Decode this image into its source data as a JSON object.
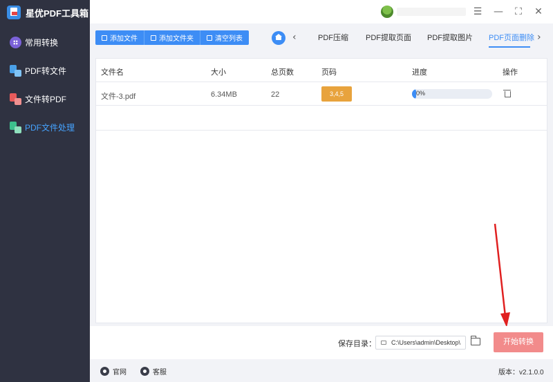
{
  "app": {
    "name": "星优PDF工具箱"
  },
  "sidebar": {
    "items": [
      {
        "label": "常用转换",
        "icon": "grid-icon"
      },
      {
        "label": "PDF转文件",
        "icon": "pdf-to-file-icon"
      },
      {
        "label": "文件转PDF",
        "icon": "file-to-pdf-icon"
      },
      {
        "label": "PDF文件处理",
        "icon": "pdf-process-icon",
        "active": true
      }
    ]
  },
  "window": {
    "settings_icon": "sliders-icon",
    "minimize": "—",
    "maximize": "⛶",
    "close": "✕"
  },
  "toolbar": {
    "add_file": "添加文件",
    "add_folder": "添加文件夹",
    "clear_list": "清空列表"
  },
  "tabs": {
    "items": [
      "PDF压缩",
      "PDF提取页面",
      "PDF提取图片",
      "PDF页面删除"
    ],
    "active_index": 3
  },
  "table": {
    "headers": [
      "文件名",
      "大小",
      "总页数",
      "页码",
      "进度",
      "操作"
    ],
    "rows": [
      {
        "name": "文件-3.pdf",
        "size": "6.34MB",
        "pages": "22",
        "page_range": "3,4,5",
        "progress_text": "0%",
        "progress": 0
      }
    ]
  },
  "save": {
    "label": "保存目录：",
    "path": "C:\\Users\\admin\\Desktop\\",
    "start_label": "开始转换"
  },
  "footer": {
    "website": "官网",
    "support": "客服",
    "version": "版本：v2.1.0.0"
  },
  "colors": {
    "accent": "#3d8df5",
    "sidebar_bg": "#2f3241",
    "page_badge": "#e8a33d",
    "start_button": "#f28b8b",
    "annotation_arrow": "#e02020"
  }
}
